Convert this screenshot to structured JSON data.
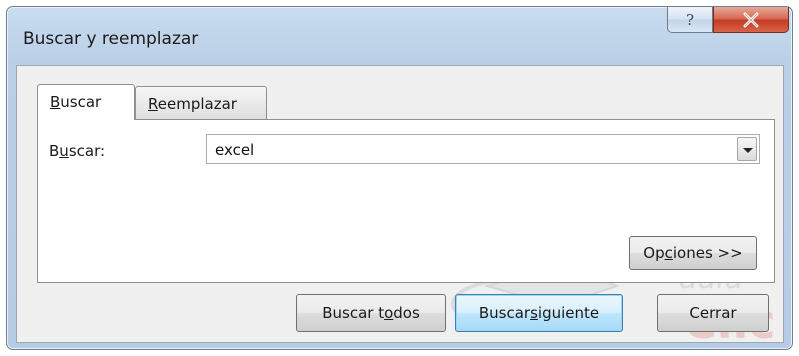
{
  "window": {
    "title": "Buscar y reemplazar",
    "help_glyph": "?",
    "close_glyph": "X"
  },
  "tabs": [
    {
      "label_underlined": "B",
      "label_rest": "uscar",
      "active": true
    },
    {
      "label_underlined": "R",
      "label_rest": "eemplazar",
      "active": false
    }
  ],
  "find": {
    "label_pre": "B",
    "label_underlined": "u",
    "label_post": "scar:",
    "value": "excel"
  },
  "buttons": {
    "options": {
      "pre": "Op",
      "u": "c",
      "post": "iones >>"
    },
    "find_all": {
      "pre": "Buscar t",
      "u": "o",
      "post": "dos"
    },
    "find_next": {
      "pre": "Buscar ",
      "u": "s",
      "post": "iguiente"
    },
    "close": "Cerrar"
  },
  "watermark": {
    "text_top": "aula",
    "text_bottom": "Clic"
  },
  "colors": {
    "title_gradient_top": "#c9dcef",
    "close_red": "#c43b22",
    "default_button_blue": "#3c7fb1"
  },
  "icons": {
    "help": "help-icon",
    "close": "close-icon",
    "dropdown": "chevron-down-icon",
    "watermark": "aulaclic-logo"
  }
}
